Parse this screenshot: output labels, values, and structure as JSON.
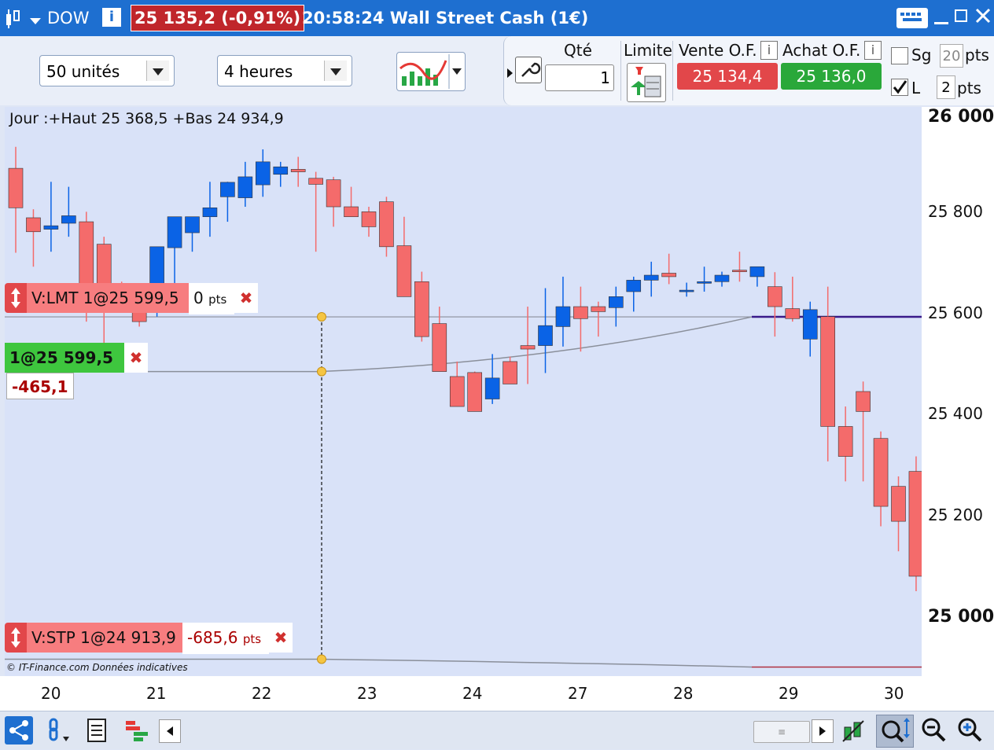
{
  "titlebar": {
    "instrument": "DOW",
    "price_change": "25 135,2 (-0,91%)",
    "time_and_name": "20:58:24 Wall Street Cash (1€)"
  },
  "toolbar": {
    "units_select": "50 unités",
    "period_select": "4 heures",
    "qty_label": "Qté",
    "qty_value": "1",
    "limit_label": "Limite",
    "sell_label": "Vente O.F.",
    "buy_label": "Achat O.F.",
    "sell_price": "25 134,4",
    "buy_price": "25 136,0",
    "sg_label": "Sg",
    "sg_value": "20",
    "pts_label": "pts",
    "l_label": "L",
    "l_value": "2",
    "pts_label2": "pts"
  },
  "chart": {
    "day_info": "Jour :+Haut 25 368,5 +Bas 24 934,9",
    "copyright": "© IT-Finance.com Données indicatives",
    "limit_order": {
      "label": "V:LMT 1@25 599,5",
      "pts": "0",
      "pts_unit": "pts"
    },
    "position": {
      "label": "1@25 599,5",
      "pnl": "-465,1"
    },
    "stop_order": {
      "label": "V:STP 1@24 913,9",
      "pts": "-685,6",
      "pts_unit": "pts"
    },
    "colors": {
      "up": "#0a63e6",
      "down": "#f46b6b",
      "bg": "#d9e2f8"
    }
  },
  "y_axis": [
    "26 000",
    "25 800",
    "25 600",
    "25 400",
    "25 200",
    "25 000"
  ],
  "x_axis": [
    "20",
    "21",
    "22",
    "23",
    "24",
    "27",
    "28",
    "29",
    "30"
  ],
  "chart_data": {
    "type": "candlestick",
    "ylim": [
      24880,
      26020
    ],
    "candles": [
      [
        25897,
        25940,
        25728,
        25818
      ],
      [
        25798,
        25815,
        25700,
        25770
      ],
      [
        25775,
        25870,
        25730,
        25782
      ],
      [
        25787,
        25860,
        25760,
        25802
      ],
      [
        25790,
        25810,
        25590,
        25650
      ],
      [
        25745,
        25760,
        25530,
        25615
      ],
      [
        25660,
        25670,
        25640,
        25615
      ],
      [
        25620,
        25660,
        25580,
        25590
      ],
      [
        25665,
        25740,
        25600,
        25740
      ],
      [
        25738,
        25790,
        25660,
        25800
      ],
      [
        25768,
        25790,
        25730,
        25800
      ],
      [
        25800,
        25870,
        25760,
        25818
      ],
      [
        25840,
        25870,
        25790,
        25869
      ],
      [
        25838,
        25910,
        25820,
        25880
      ],
      [
        25864,
        25935,
        25840,
        25910
      ],
      [
        25885,
        25910,
        25860,
        25900
      ],
      [
        25895,
        25920,
        25860,
        25890
      ],
      [
        25877,
        25890,
        25730,
        25865
      ],
      [
        25874,
        25880,
        25780,
        25820
      ],
      [
        25820,
        25860,
        25800,
        25800
      ],
      [
        25810,
        25820,
        25760,
        25780
      ],
      [
        25830,
        25840,
        25720,
        25740
      ],
      [
        25742,
        25800,
        25640,
        25640
      ],
      [
        25670,
        25690,
        25550,
        25560
      ],
      [
        25586,
        25620,
        25490,
        25490
      ],
      [
        25480,
        25510,
        25420,
        25420
      ],
      [
        25488,
        25490,
        25410,
        25410
      ],
      [
        25435,
        25525,
        25425,
        25477
      ],
      [
        25510,
        25520,
        25470,
        25465
      ],
      [
        25542,
        25620,
        25465,
        25535
      ],
      [
        25542,
        25657,
        25487,
        25582
      ],
      [
        25580,
        25680,
        25540,
        25620
      ],
      [
        25620,
        25660,
        25530,
        25596
      ],
      [
        25620,
        25630,
        25560,
        25610
      ],
      [
        25618,
        25660,
        25580,
        25640
      ],
      [
        25650,
        25680,
        25610,
        25673
      ],
      [
        25673,
        25710,
        25640,
        25683
      ],
      [
        25687,
        25726,
        25665,
        25680
      ],
      [
        25650,
        25668,
        25640,
        25653
      ],
      [
        25670,
        25700,
        25650,
        25670
      ],
      [
        25670,
        25690,
        25660,
        25683
      ],
      [
        25693,
        25730,
        25670,
        25690
      ],
      [
        25680,
        25700,
        25660,
        25700
      ],
      [
        25660,
        25689,
        25560,
        25620
      ],
      [
        25616,
        25680,
        25590,
        25596
      ],
      [
        25555,
        25630,
        25520,
        25614
      ],
      [
        25600,
        25660,
        25310,
        25380
      ],
      [
        25380,
        25420,
        25270,
        25320
      ],
      [
        25450,
        25470,
        25270,
        25410
      ],
      [
        25356,
        25370,
        25180,
        25220
      ],
      [
        25260,
        25280,
        25130,
        25190
      ],
      [
        25290,
        25320,
        25050,
        25080
      ],
      [
        25150,
        25160,
        24960,
        25070
      ]
    ]
  }
}
